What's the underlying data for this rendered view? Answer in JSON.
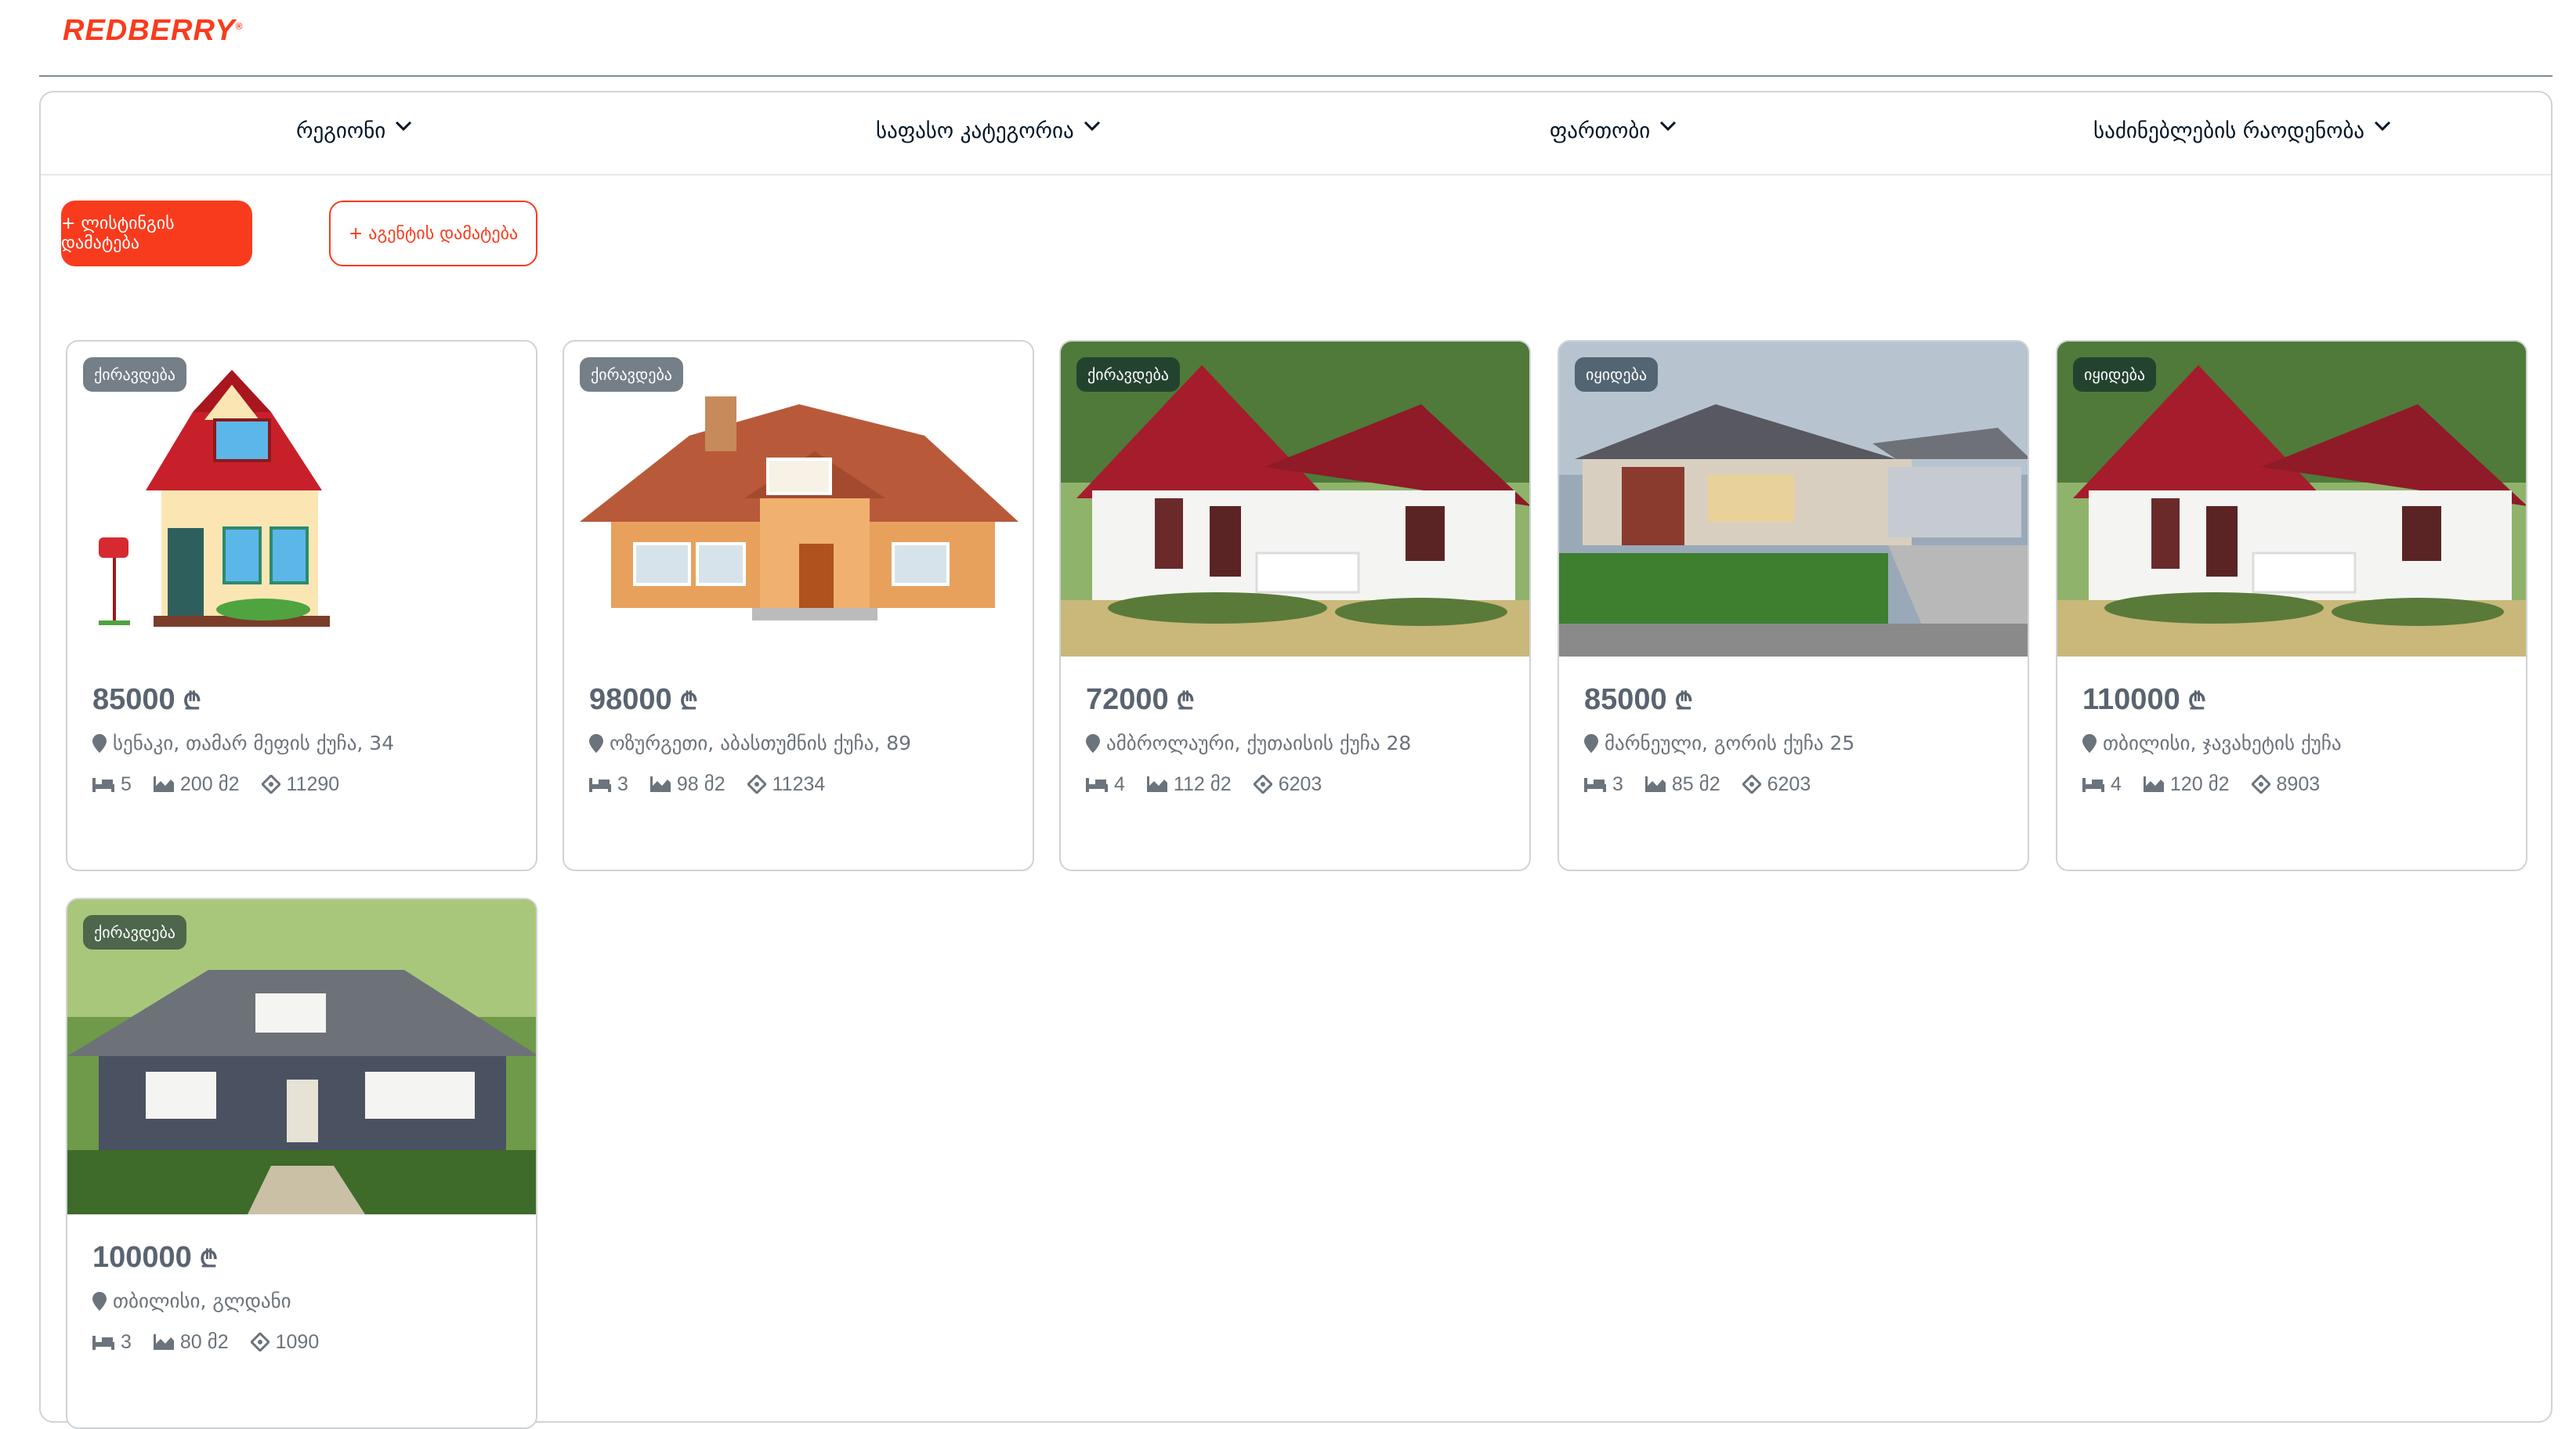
{
  "app": {
    "logo": "REDBERRY",
    "logo_mark": "®"
  },
  "filters": [
    {
      "label": "რეგიონი"
    },
    {
      "label": "საფასო კატეგორია"
    },
    {
      "label": "ფართობი"
    },
    {
      "label": "საძინებლების რაოდენობა"
    }
  ],
  "actions": {
    "add_listing": "+ ლისტინგის დამატება",
    "add_agent": "+ აგენტის დამატება"
  },
  "currency_symbol": "₾",
  "listings": [
    {
      "badge": "ქირავდება",
      "price": "85000",
      "address": "სენაკი, თამარ მეფის ქუჩა, 34",
      "bedrooms": "5",
      "area": "200 მ2",
      "zip": "11290",
      "image": "cartoon-red-roof-house"
    },
    {
      "badge": "ქირავდება",
      "price": "98000",
      "address": "ოზურგეთი, აბასთუმნის ქუჩა, 89",
      "bedrooms": "3",
      "area": "98 მ2",
      "zip": "11234",
      "image": "wooden-house"
    },
    {
      "badge": "ქირავდება",
      "price": "72000",
      "address": "ამბროლაური, ქუთაისის ქუჩა 28",
      "bedrooms": "4",
      "area": "112 მ2",
      "zip": "6203",
      "image": "white-house-red-roof"
    },
    {
      "badge": "იყიდება",
      "price": "85000",
      "address": "მარნეული, გორის ქუჩა 25",
      "bedrooms": "3",
      "area": "85 მ2",
      "zip": "6203",
      "image": "modern-house"
    },
    {
      "badge": "იყიდება",
      "price": "110000",
      "address": "თბილისი, ჯავახეტის ქუჩა",
      "bedrooms": "4",
      "area": "120 მ2",
      "zip": "8903",
      "image": "white-house-red-roof"
    },
    {
      "badge": "ქირავდება",
      "price": "100000",
      "address": "თბილისი, გლდანი",
      "bedrooms": "3",
      "area": "80 მ2",
      "zip": "1090",
      "image": "gray-house-porch"
    }
  ],
  "colors": {
    "accent": "#F93B1D",
    "text": "#021526",
    "muted": "#6b737c"
  }
}
